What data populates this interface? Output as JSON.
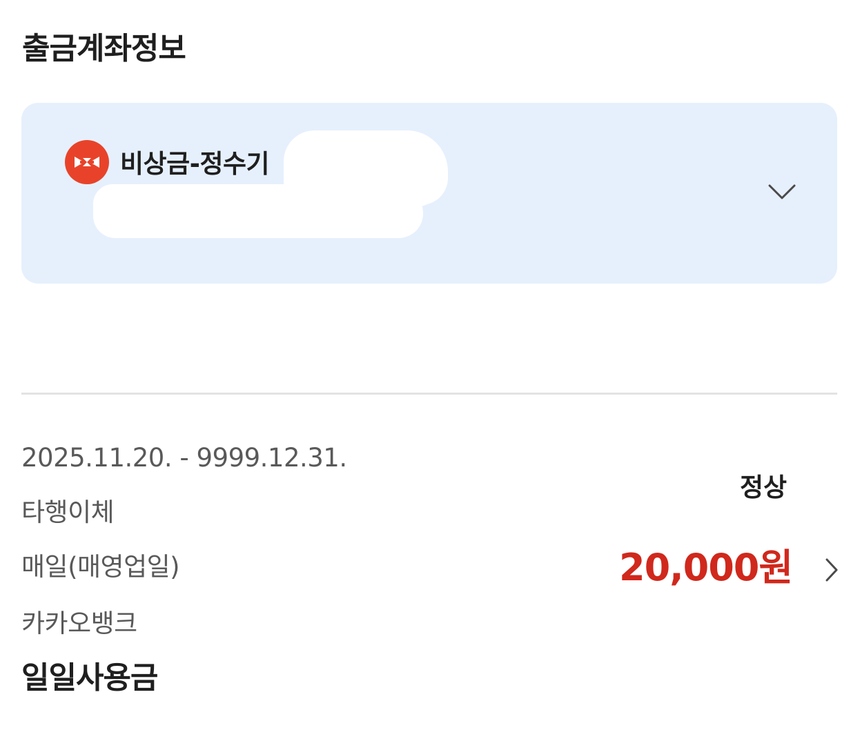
{
  "header": {
    "title": "출금계좌정보"
  },
  "account": {
    "name": "비상금-정수기",
    "logo_icon": "bank-logo-icon",
    "logo_color": "#e8432a",
    "card_color": "#e6f0fd",
    "expand_icon": "chevron-down-icon"
  },
  "transfer": {
    "period": "2025.11.20. - 9999.12.31.",
    "type": "타행이체",
    "frequency": "매일(매영업일)",
    "bank": "카카오뱅크",
    "status": "정상",
    "amount": "20,000원",
    "amount_color": "#d0281c",
    "detail_icon": "chevron-right-icon",
    "name": "일일사용금"
  }
}
